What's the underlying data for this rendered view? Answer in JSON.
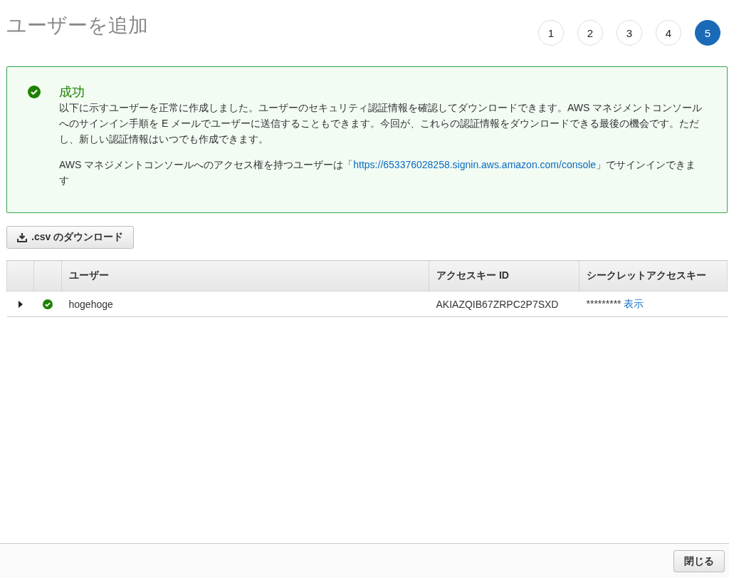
{
  "page": {
    "title": "ユーザーを追加"
  },
  "steps": [
    {
      "label": "1",
      "selected": false
    },
    {
      "label": "2",
      "selected": false
    },
    {
      "label": "3",
      "selected": false
    },
    {
      "label": "4",
      "selected": false
    },
    {
      "label": "5",
      "selected": true
    }
  ],
  "alert": {
    "kind": "success",
    "title": "成功",
    "message": "以下に示すユーザーを正常に作成しました。ユーザーのセキュリティ認証情報を確認してダウンロードできます。AWS マネジメントコンソールへのサインイン手順を E メールでユーザーに送信することもできます。今回が、これらの認証情報をダウンロードできる最後の機会です。ただし、新しい認証情報はいつでも作成できます。",
    "signin_before": "AWS マネジメントコンソールへのアクセス権を持つユーザーは「",
    "signin_link": "https://653376028258.signin.aws.amazon.com/console",
    "signin_after": "」でサインインできます"
  },
  "download_button": ".csv のダウンロード",
  "table": {
    "columns": [
      "ユーザー",
      "アクセスキー ID",
      "シークレットアクセスキー"
    ],
    "rows": [
      {
        "expanded": false,
        "succeeded": true,
        "user": "hogehoge",
        "access_key_id": "AKIAZQIB67ZRPC2P7SXD",
        "secret_mask": "*********",
        "show_link": "表示"
      }
    ]
  },
  "footer": {
    "close_button": "閉じる"
  }
}
